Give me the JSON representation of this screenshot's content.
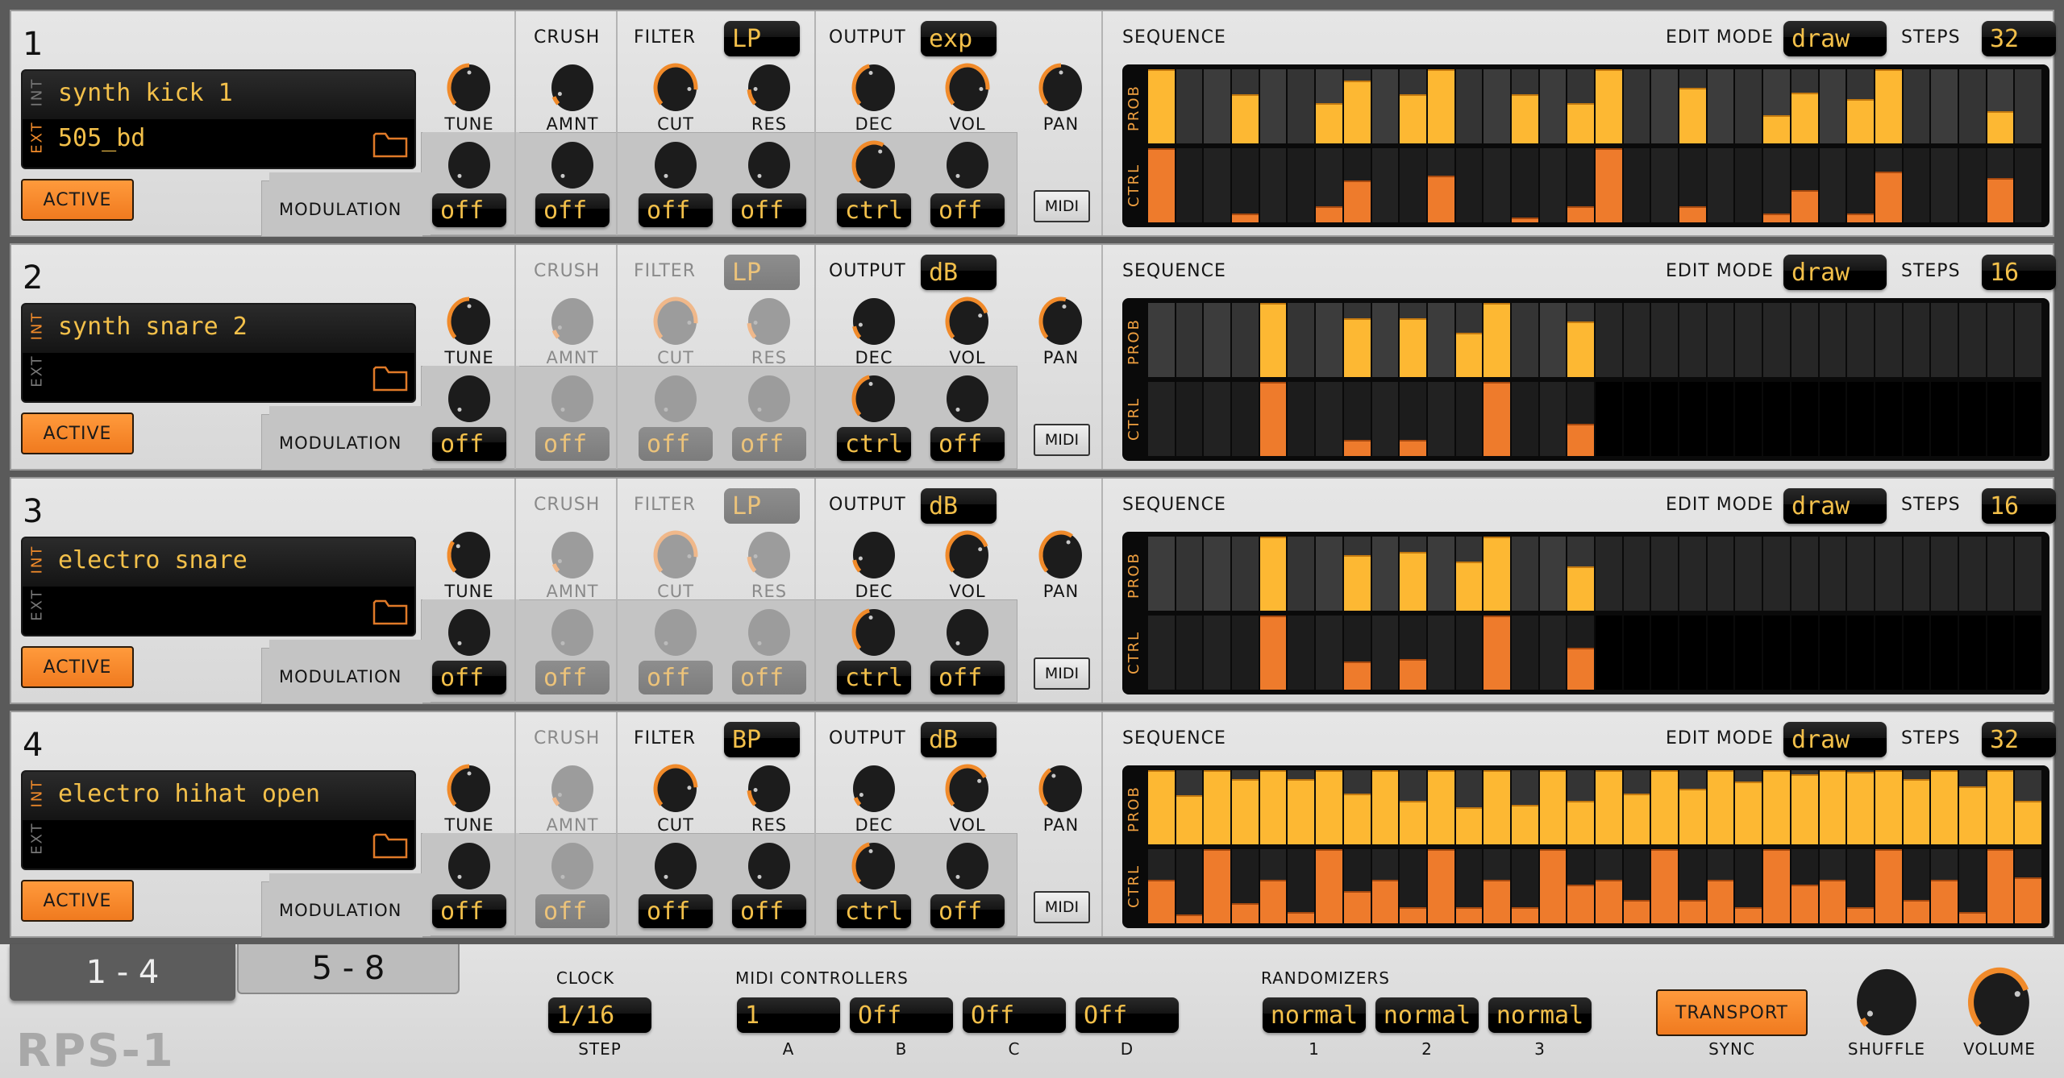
{
  "app": {
    "name": "RPS-1"
  },
  "colors": {
    "accent": "#f07a1f",
    "lcd_text": "#f3c04a",
    "prob_bar": "#fdb833",
    "ctrl_bar": "#ee7b2c"
  },
  "labels": {
    "crush": "CRUSH",
    "filter": "FILTER",
    "output": "OUTPUT",
    "sequence": "SEQUENCE",
    "edit_mode": "EDIT MODE",
    "steps": "STEPS",
    "tune": "TUNE",
    "amnt": "AMNT",
    "cut": "CUT",
    "res": "RES",
    "dec": "DEC",
    "vol": "VOL",
    "pan": "PAN",
    "modulation": "MODULATION",
    "midi": "MIDI",
    "active": "ACTIVE",
    "int": "INT",
    "ext": "EXT",
    "prob": "PROB",
    "ctrl": "CTRL"
  },
  "tracks": [
    {
      "number": "1",
      "source": "ext",
      "int_sample": "synth kick 1",
      "ext_sample": "505_bd",
      "crush_enabled": true,
      "filter_enabled": true,
      "filter_type": "LP",
      "output_mode": "exp",
      "knobs": {
        "tune": 0.5,
        "amnt": 0.08,
        "cut": 0.85,
        "res": 0.15,
        "dec": 0.45,
        "vol": 0.85,
        "pan": 0.5
      },
      "mod_knobs": {
        "tune": 0.0,
        "amnt": 0.0,
        "cut": 0.0,
        "res": 0.0,
        "dec": 0.6,
        "vol": 0.0
      },
      "mod_values": {
        "tune": "off",
        "amnt": "off",
        "cut": "off",
        "res": "off",
        "dec": "ctrl",
        "vol": "off"
      },
      "edit_mode": "draw",
      "steps": "32",
      "step_count": 32,
      "prob": [
        1.0,
        0,
        0,
        0.66,
        0,
        0,
        0.54,
        0.85,
        0,
        0.66,
        1.0,
        0,
        0,
        0.66,
        0,
        0.54,
        1.0,
        0,
        0,
        0.75,
        0,
        0,
        0.38,
        0.69,
        0,
        0.6,
        1.0,
        0,
        0,
        0,
        0.44,
        0
      ],
      "ctrl": [
        1.0,
        0,
        0,
        0.12,
        0,
        0,
        0.22,
        0.57,
        0,
        0,
        0.63,
        0,
        0,
        0.06,
        0,
        0.22,
        1.0,
        0,
        0,
        0.22,
        0,
        0,
        0.12,
        0.44,
        0,
        0.12,
        0.69,
        0,
        0,
        0,
        0.6,
        0
      ]
    },
    {
      "number": "2",
      "source": "int",
      "int_sample": "synth snare 2",
      "ext_sample": "",
      "crush_enabled": false,
      "filter_enabled": false,
      "filter_type": "LP",
      "output_mode": "dB",
      "knobs": {
        "tune": 0.5,
        "amnt": 0.08,
        "cut": 0.85,
        "res": 0.15,
        "dec": 0.12,
        "vol": 0.75,
        "pan": 0.55
      },
      "mod_knobs": {
        "tune": 0.0,
        "amnt": 0.0,
        "cut": 0.0,
        "res": 0.0,
        "dec": 0.45,
        "vol": 0.0
      },
      "mod_values": {
        "tune": "off",
        "amnt": "off",
        "cut": "off",
        "res": "off",
        "dec": "ctrl",
        "vol": "off"
      },
      "edit_mode": "draw",
      "steps": "16",
      "step_count": 16,
      "prob": [
        0,
        0,
        0,
        0,
        1.0,
        0,
        0,
        0.79,
        0,
        0.79,
        0,
        0.6,
        1.0,
        0,
        0,
        0.75
      ],
      "ctrl": [
        0,
        0,
        0,
        0,
        1.0,
        0,
        0,
        0.22,
        0,
        0.22,
        0,
        0,
        1.0,
        0,
        0,
        0.44
      ]
    },
    {
      "number": "3",
      "source": "int",
      "int_sample": "electro snare",
      "ext_sample": "",
      "crush_enabled": false,
      "filter_enabled": false,
      "filter_type": "LP",
      "output_mode": "dB",
      "knobs": {
        "tune": 0.3,
        "amnt": 0.08,
        "cut": 0.85,
        "res": 0.15,
        "dec": 0.12,
        "vol": 0.75,
        "pan": 0.62
      },
      "mod_knobs": {
        "tune": 0.0,
        "amnt": 0.0,
        "cut": 0.0,
        "res": 0.0,
        "dec": 0.45,
        "vol": 0.0
      },
      "mod_values": {
        "tune": "off",
        "amnt": "off",
        "cut": "off",
        "res": "off",
        "dec": "ctrl",
        "vol": "off"
      },
      "edit_mode": "draw",
      "steps": "16",
      "step_count": 16,
      "prob": [
        0,
        0,
        0,
        0,
        1.0,
        0,
        0,
        0.75,
        0,
        0.79,
        0,
        0.66,
        1.0,
        0,
        0,
        0.6
      ],
      "ctrl": [
        0,
        0,
        0,
        0,
        1.0,
        0,
        0,
        0.38,
        0,
        0.41,
        0,
        0,
        1.0,
        0,
        0,
        0.57
      ]
    },
    {
      "number": "4",
      "source": "int",
      "int_sample": "electro hihat open",
      "ext_sample": "",
      "crush_enabled": false,
      "filter_enabled": true,
      "filter_type": "BP",
      "output_mode": "dB",
      "knobs": {
        "tune": 0.5,
        "amnt": 0.08,
        "cut": 0.82,
        "res": 0.15,
        "dec": 0.08,
        "vol": 0.72,
        "pan": 0.38
      },
      "mod_knobs": {
        "tune": 0.0,
        "amnt": 0.0,
        "cut": 0.0,
        "res": 0.0,
        "dec": 0.45,
        "vol": 0.0
      },
      "mod_values": {
        "tune": "off",
        "amnt": "off",
        "cut": "off",
        "res": "off",
        "dec": "ctrl",
        "vol": "off"
      },
      "edit_mode": "draw",
      "steps": "32",
      "step_count": 32,
      "prob": [
        1.0,
        0.66,
        1.0,
        0.88,
        1.0,
        0.88,
        1.0,
        0.68,
        1.0,
        0.59,
        1.0,
        0.5,
        1.0,
        0.53,
        1.0,
        0.59,
        1.0,
        0.68,
        1.0,
        0.75,
        1.0,
        0.85,
        1.0,
        0.95,
        1.0,
        0.98,
        1.0,
        0.88,
        1.0,
        0.78,
        1.0,
        0.59
      ],
      "ctrl": [
        0.59,
        0.12,
        1.0,
        0.27,
        0.59,
        0.15,
        1.0,
        0.43,
        0.59,
        0.22,
        1.0,
        0.22,
        0.59,
        0.22,
        1.0,
        0.52,
        0.59,
        0.31,
        1.0,
        0.31,
        0.59,
        0.22,
        1.0,
        0.52,
        0.59,
        0.22,
        1.0,
        0.31,
        0.59,
        0.15,
        1.0,
        0.62
      ]
    }
  ],
  "bottom": {
    "tabs": [
      {
        "label": "1 - 4",
        "selected": true
      },
      {
        "label": "5 - 8",
        "selected": false
      }
    ],
    "clock": {
      "title": "CLOCK",
      "value": "1/16",
      "sublabel": "STEP"
    },
    "midi_controllers": {
      "title": "MIDI CONTROLLERS",
      "items": [
        {
          "value": "1",
          "label": "A"
        },
        {
          "value": "Off",
          "label": "B"
        },
        {
          "value": "Off",
          "label": "C"
        },
        {
          "value": "Off",
          "label": "D"
        }
      ]
    },
    "randomizers": {
      "title": "RANDOMIZERS",
      "items": [
        {
          "value": "normal",
          "label": "1"
        },
        {
          "value": "normal",
          "label": "2"
        },
        {
          "value": "normal",
          "label": "3"
        }
      ]
    },
    "transport": {
      "label": "TRANSPORT",
      "sublabel": "SYNC"
    },
    "shuffle": {
      "label": "SHUFFLE",
      "value": 0.05
    },
    "volume": {
      "label": "VOLUME",
      "value": 0.75
    }
  }
}
